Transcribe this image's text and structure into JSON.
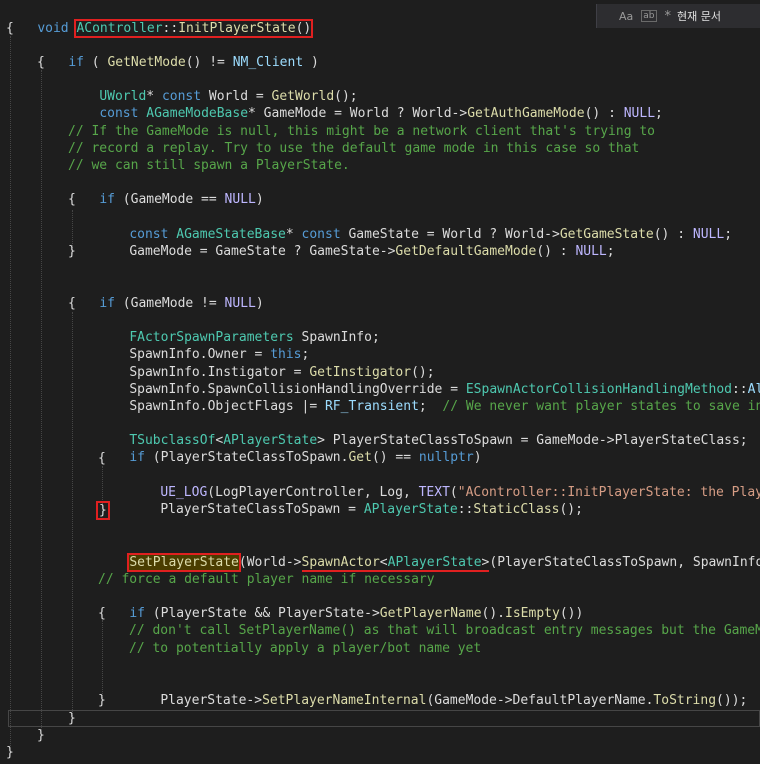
{
  "findbar": {
    "match_case_icon_label": "Aa",
    "whole_word_icon_label": "ab",
    "regex_icon_label": "*",
    "scope_label": "현재 문서"
  },
  "code": {
    "l1": {
      "a": "void ",
      "b": "AController",
      "c": "::",
      "d": "InitPlayerState",
      "e": "()"
    },
    "l2": "{",
    "l3": {
      "a": "if",
      "b": " ( ",
      "c": "GetNetMode",
      "d": "() != ",
      "e": "NM_Client",
      "f": " )"
    },
    "l4": "{",
    "l5": {
      "a": "UWorld",
      "b": "* ",
      "c": "const",
      "d": " World = ",
      "e": "GetWorld",
      "f": "();"
    },
    "l6": {
      "a": "const",
      "b": " ",
      "c": "AGameModeBase",
      "d": "* GameMode = World ? World->",
      "e": "GetAuthGameMode",
      "f": "() : ",
      "g": "NULL",
      "h": ";"
    },
    "l7": "// If the GameMode is null, this might be a network client that's trying to",
    "l8": "// record a replay. Try to use the default game mode in this case so that",
    "l9": "// we can still spawn a PlayerState.",
    "l10": {
      "a": "if",
      "b": " (GameMode == ",
      "c": "NULL",
      "d": ")"
    },
    "l11": "{",
    "l12": {
      "a": "const",
      "b": " ",
      "c": "AGameStateBase",
      "d": "* ",
      "e": "const",
      "f": " GameState = World ? World->",
      "g": "GetGameState",
      "h": "() : ",
      "i": "NULL",
      "j": ";"
    },
    "l13": {
      "a": "GameMode = GameState ? GameState->",
      "b": "GetDefaultGameMode",
      "c": "() : ",
      "d": "NULL",
      "e": ";"
    },
    "l14": "}",
    "l15": {
      "a": "if",
      "b": " (GameMode != ",
      "c": "NULL",
      "d": ")"
    },
    "l16": "{",
    "l17": {
      "a": "FActorSpawnParameters",
      "b": " SpawnInfo;"
    },
    "l18": {
      "a": "SpawnInfo.Owner = ",
      "b": "this",
      "c": ";"
    },
    "l19": {
      "a": "SpawnInfo.Instigator = ",
      "b": "GetInstigator",
      "c": "();"
    },
    "l20": {
      "a": "SpawnInfo.SpawnCollisionHandlingOverride = ",
      "b": "ESpawnActorCollisionHandlingMethod",
      "c": "::",
      "d": "AlwaysSpawn;"
    },
    "l21": {
      "a": "SpawnInfo.ObjectFlags |= ",
      "b": "RF_Transient",
      "c": ";  ",
      "d": "// We never want player states to save into a map"
    },
    "l22": {
      "a": "TSubclassOf",
      "b": "<",
      "c": "APlayerState",
      "d": "> PlayerStateClassToSpawn = GameMode->PlayerStateClass;"
    },
    "l23": {
      "a": "if",
      "b": " (PlayerStateClassToSpawn.",
      "c": "Get",
      "d": "() == ",
      "e": "nullptr",
      "f": ")"
    },
    "l24": "{",
    "l25": {
      "a": "UE_LOG",
      "b": "(LogPlayerController, Log, ",
      "c": "TEXT",
      "d": "(",
      "e": "\"AController::InitPlayerState: the PlayerStateClass"
    },
    "l26": {
      "a": "PlayerStateClassToSpawn = ",
      "b": "APlayerState",
      "c": "::",
      "d": "StaticClass",
      "e": "();"
    },
    "l27": "}",
    "l28": {
      "a": "SetPlayerState",
      "b": "(World->",
      "c": "SpawnActor",
      "d": "<",
      "e": "APlayerState",
      "f": ">",
      "g": "(PlayerStateClassToSpawn, SpawnInfo));"
    },
    "l29": "// force a default player name if necessary",
    "l30": {
      "a": "if",
      "b": " (PlayerState && PlayerState->",
      "c": "GetPlayerName",
      "d": "().",
      "e": "IsEmpty",
      "f": "())"
    },
    "l31": "{",
    "l32": "// don't call SetPlayerName() as that will broadcast entry messages but the GameMode",
    "l33": "// to potentially apply a player/bot name yet",
    "l34": {
      "a": "PlayerState->",
      "b": "SetPlayerNameInternal",
      "c": "(GameMode->DefaultPlayerName.",
      "d": "ToString",
      "e": "());"
    },
    "l35": "}",
    "l36": "}",
    "l37": "}",
    "l38": "}"
  }
}
